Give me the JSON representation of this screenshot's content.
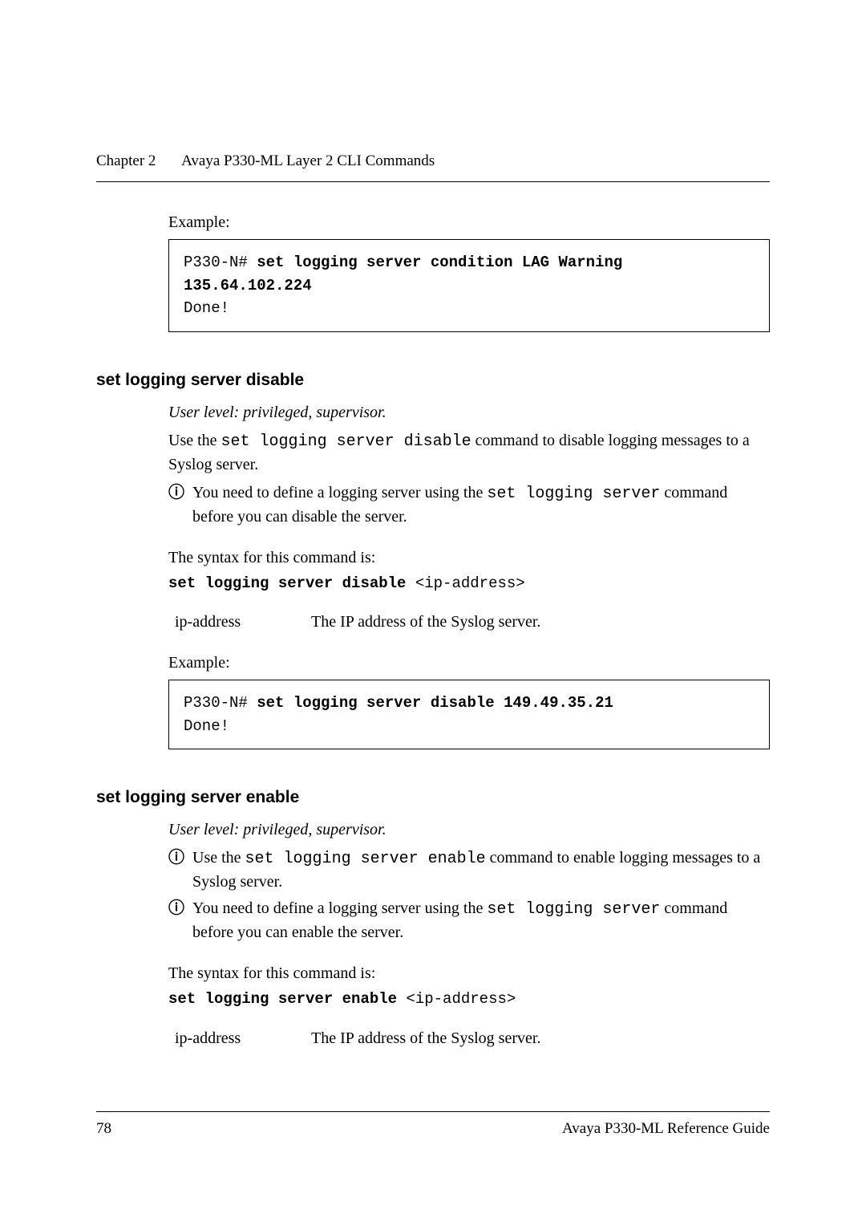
{
  "header": {
    "chapter": "Chapter 2",
    "title": "Avaya P330-ML Layer 2 CLI Commands"
  },
  "sec0": {
    "example_label": "Example:",
    "code_prompt": "P330-N# ",
    "code_cmd": "set logging server condition LAG Warning 135.64.102.224",
    "code_result": "Done!"
  },
  "sec1": {
    "title": "set logging server disable",
    "userlevel": "User level: privileged, supervisor.",
    "desc_pre": "Use the ",
    "desc_cmd": "set logging server disable",
    "desc_post": " command to disable logging messages to a Syslog server.",
    "note_pre": "You need to define a logging server using the ",
    "note_cmd": "set logging server",
    "note_post": " command before you can disable the server.",
    "syntax_label": "The syntax for this command is:",
    "syntax_bold": "set logging server disable",
    "syntax_arg": " <ip-address>",
    "param_name": "ip-address",
    "param_desc": "The IP address of the Syslog server.",
    "example_label": "Example:",
    "code_prompt": "P330-N# ",
    "code_cmd": "set logging server disable 149.49.35.21",
    "code_result": "Done!"
  },
  "sec2": {
    "title": "set logging server enable",
    "userlevel": "User level: privileged, supervisor.",
    "note1_pre": "Use the ",
    "note1_cmd": "set logging server enable",
    "note1_post": " command to enable logging messages to a Syslog server.",
    "note2_pre": "You need to define a logging server using the ",
    "note2_cmd": "set logging server",
    "note2_post": " command before you can enable the server.",
    "syntax_label": "The syntax for this command is:",
    "syntax_bold": "set logging server enable",
    "syntax_arg": " <ip-address>",
    "param_name": "ip-address",
    "param_desc": "The IP address of the Syslog server."
  },
  "footer": {
    "page": "78",
    "doc": "Avaya P330-ML Reference Guide"
  },
  "icons": {
    "info": "ⓘ"
  }
}
